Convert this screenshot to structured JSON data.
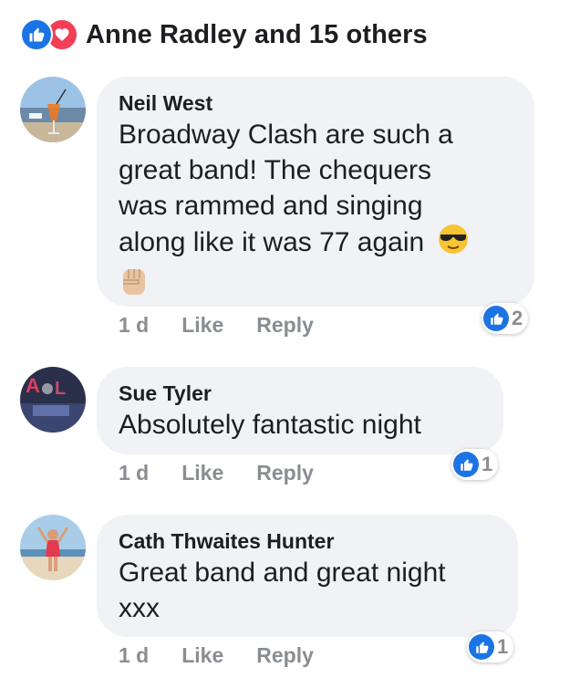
{
  "reactions": {
    "summary": "Anne Radley and 15 others",
    "types": [
      "like-icon",
      "love-icon"
    ],
    "like_color": "#1b74e4",
    "love_color": "#f33e58"
  },
  "comments": [
    {
      "author": "Neil West",
      "lines": [
        "Broadway Clash are such a",
        "great band! The chequers",
        "was rammed and singing",
        "along like it was 77 again"
      ],
      "emoji": [
        "sunglasses-emoji",
        "raised-fist-emoji"
      ],
      "time": "1 d",
      "like_label": "Like",
      "reply_label": "Reply",
      "like_count": "2"
    },
    {
      "author": "Sue Tyler",
      "lines": [
        "Absolutely fantastic night"
      ],
      "time": "1 d",
      "like_label": "Like",
      "reply_label": "Reply",
      "like_count": "1"
    },
    {
      "author": "Cath Thwaites Hunter",
      "lines": [
        "Great band and great night",
        "xxx"
      ],
      "time": "1 d",
      "like_label": "Like",
      "reply_label": "Reply",
      "like_count": "1"
    }
  ],
  "colors": {
    "bubble": "#f0f2f5",
    "meta_text": "#8a8d91",
    "text": "#1c1e21"
  }
}
